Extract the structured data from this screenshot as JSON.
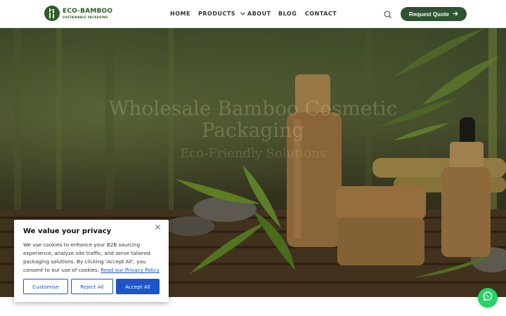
{
  "brand": {
    "name": "ECO-BAMBOO",
    "tagline": "SUSTAINABLE PACKAGING",
    "color": "#2f5a2a"
  },
  "nav": {
    "items": [
      {
        "label": "HOME"
      },
      {
        "label": "PRODUCTS"
      },
      {
        "label": "ABOUT"
      },
      {
        "label": "BLOG"
      },
      {
        "label": "CONTACT"
      }
    ]
  },
  "header": {
    "search_icon": "search-icon",
    "quote_label": "Request Quote",
    "quote_color": "#2f5230"
  },
  "hero": {
    "title": "Wholesale Bamboo Cosmetic Packaging",
    "subtitle": "Eco-Friendly Solutions"
  },
  "cookie": {
    "title": "We value your privacy",
    "text": "We use cookies to enhance your B2B sourcing experience, analyze site traffic, and serve tailored packaging solutions. By clicking 'Accept All', you consent to our use of cookies.",
    "link": "Read our Privacy Policy",
    "customise": "Customise",
    "reject": "Reject All",
    "accept": "Accept All",
    "accent": "#1a55c9"
  },
  "whatsapp": {
    "icon": "whatsapp-icon",
    "color": "#25d366"
  }
}
